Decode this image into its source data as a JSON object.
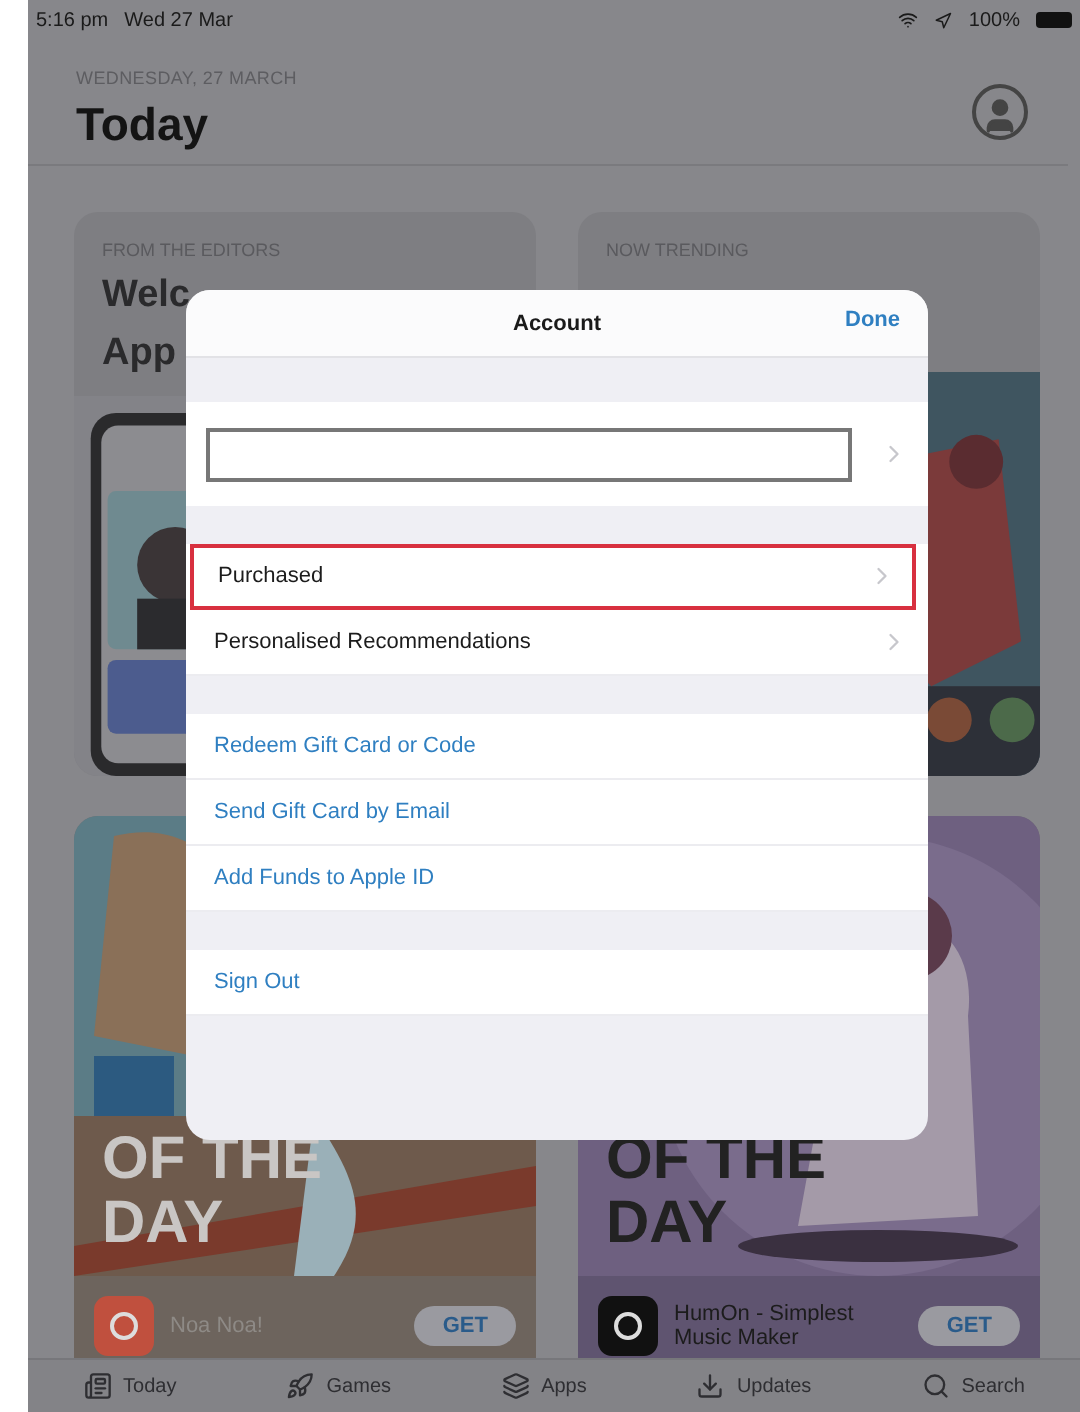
{
  "status_bar": {
    "time": "5:16 pm",
    "date": "Wed 27 Mar",
    "battery": "100%"
  },
  "header": {
    "date": "WEDNESDAY, 27 MARCH",
    "title": "Today"
  },
  "top_cards": [
    {
      "label": "FROM THE EDITORS",
      "title_lines": [
        "Welc",
        "App"
      ]
    },
    {
      "label": "NOW TRENDING"
    }
  ],
  "bottom_cards": [
    {
      "heading_lines": [
        "OF THE",
        "DAY"
      ],
      "app_name": "Noa Noa!",
      "button": "GET",
      "kind": "light"
    },
    {
      "heading_lines": [
        "OF THE",
        "DAY"
      ],
      "app_name": "HumOn - Simplest Music Maker",
      "button": "GET",
      "kind": "dark"
    }
  ],
  "tab_bar": [
    {
      "label": "Today"
    },
    {
      "label": "Games"
    },
    {
      "label": "Apps"
    },
    {
      "label": "Updates"
    },
    {
      "label": "Search"
    }
  ],
  "dialog": {
    "title": "Account",
    "done": "Done",
    "sections": [
      {
        "rows": [
          {
            "kind": "account"
          }
        ]
      },
      {
        "rows": [
          {
            "kind": "nav",
            "label": "Purchased",
            "highlighted": true
          },
          {
            "kind": "nav",
            "label": "Personalised Recommendations",
            "highlighted": false
          }
        ]
      },
      {
        "rows": [
          {
            "kind": "link",
            "label": "Redeem Gift Card or Code"
          },
          {
            "kind": "link",
            "label": "Send Gift Card by Email"
          },
          {
            "kind": "link",
            "label": "Add Funds to Apple ID"
          }
        ]
      },
      {
        "rows": [
          {
            "kind": "link",
            "label": "Sign Out"
          }
        ]
      }
    ]
  }
}
